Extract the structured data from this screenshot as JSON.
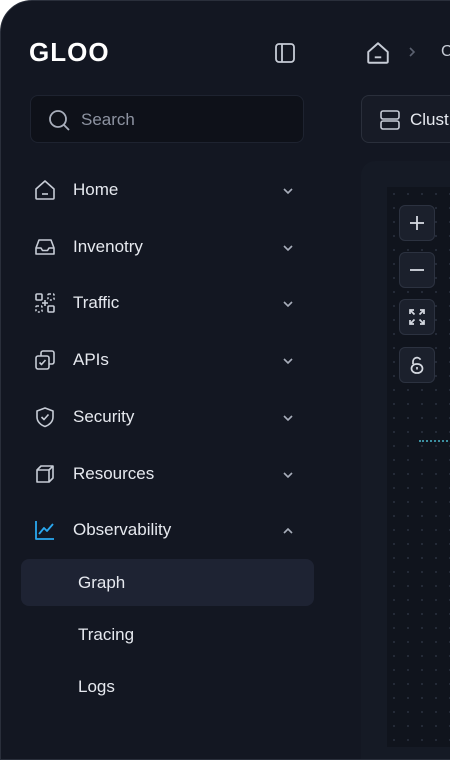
{
  "brand": {
    "logo_text": "GLOO",
    "accent": "#2aa8f0",
    "bg": "#131722"
  },
  "header": {
    "collapse_icon": "sidebar-panel-icon",
    "breadcrumb_next": "C"
  },
  "search": {
    "placeholder": "Search"
  },
  "sidebar": {
    "items": [
      {
        "label": "Home",
        "icon": "home-icon"
      },
      {
        "label": "Invenotry",
        "icon": "inventory-tray-icon"
      },
      {
        "label": "Traffic",
        "icon": "traffic-nodes-icon"
      },
      {
        "label": "APIs",
        "icon": "api-cards-icon"
      },
      {
        "label": "Security",
        "icon": "shield-check-icon"
      },
      {
        "label": "Resources",
        "icon": "box-icon"
      },
      {
        "label": "Observability",
        "icon": "chart-line-icon",
        "expanded": true
      }
    ],
    "subitems": [
      {
        "label": "Graph",
        "active": true
      },
      {
        "label": "Tracing"
      },
      {
        "label": "Logs"
      }
    ]
  },
  "toolbar": {
    "cluster_label": "Clust"
  },
  "canvas_tools": [
    "zoom-in",
    "zoom-out",
    "fit-view",
    "lock"
  ]
}
